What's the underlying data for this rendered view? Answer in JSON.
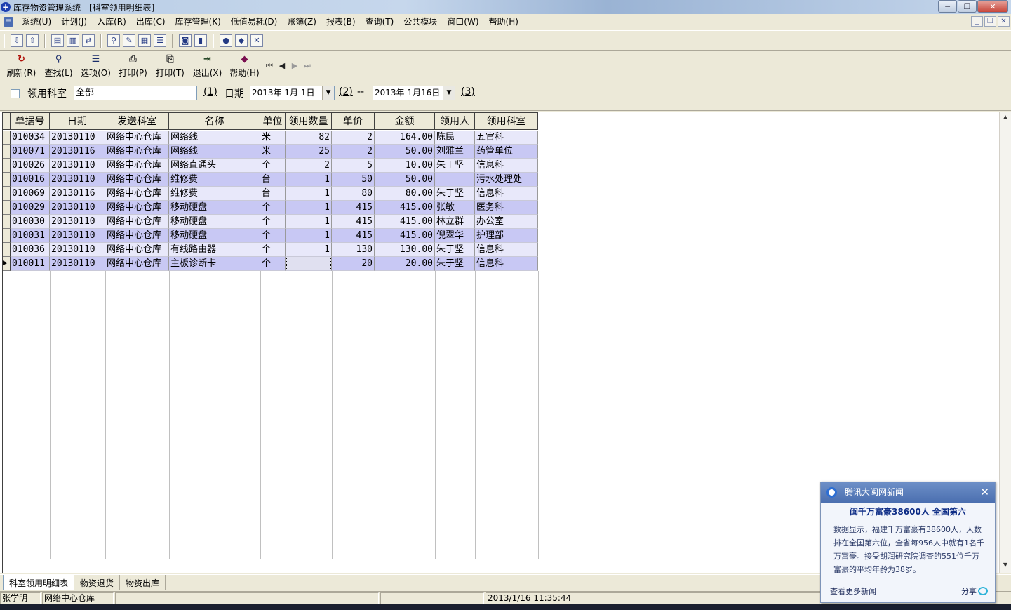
{
  "window": {
    "title": "库存物资管理系统 - [科室领用明细表]",
    "btn_minimize": "─",
    "btn_restore": "❐",
    "btn_close": "✕"
  },
  "menu": {
    "items": [
      "系统(U)",
      "计划(J)",
      "入库(R)",
      "出库(C)",
      "库存管理(K)",
      "低值易耗(D)",
      "账簿(Z)",
      "报表(B)",
      "查询(T)",
      "公共模块",
      "窗口(W)",
      "帮助(H)"
    ],
    "mdi_minimize": "_",
    "mdi_restore": "❐",
    "mdi_close": "✕"
  },
  "toolbar2": {
    "buttons": [
      {
        "label": "刷新(R)",
        "icon": "refresh-icon",
        "glyph": "↻"
      },
      {
        "label": "查找(L)",
        "icon": "search-icon",
        "glyph": "⚲"
      },
      {
        "label": "选项(O)",
        "icon": "options-icon",
        "glyph": "☰"
      },
      {
        "label": "打印(P)",
        "icon": "printer-icon",
        "glyph": "⎙"
      },
      {
        "label": "打印(T)",
        "icon": "print-preview-icon",
        "glyph": "⎘"
      },
      {
        "label": "退出(X)",
        "icon": "exit-icon",
        "glyph": "⇥"
      },
      {
        "label": "帮助(H)",
        "icon": "help-book-icon",
        "glyph": "◆"
      }
    ],
    "nav": [
      "⏮",
      "◀",
      "▶",
      "⏭"
    ]
  },
  "filter": {
    "dept_label": "领用科室",
    "dept_value": "全部",
    "marker1": "(1)",
    "date_label": "日期",
    "date_from": "2013年 1月 1日",
    "marker2": "(2)",
    "separator": "--",
    "date_to": "2013年 1月16日",
    "marker3": "(3)"
  },
  "table": {
    "columns": [
      "单据号",
      "日期",
      "发送科室",
      "名称",
      "单位",
      "领用数量",
      "单价",
      "金额",
      "领用人",
      "领用科室"
    ],
    "rows": [
      [
        "010034",
        "20130110",
        "网络中心仓库",
        "网络线",
        "米",
        "82",
        "2",
        "164.00",
        "陈民",
        "五官科"
      ],
      [
        "010071",
        "20130116",
        "网络中心仓库",
        "网络线",
        "米",
        "25",
        "2",
        "50.00",
        "刘雅兰",
        "药管单位"
      ],
      [
        "010026",
        "20130110",
        "网络中心仓库",
        "网络直通头",
        "个",
        "2",
        "5",
        "10.00",
        "朱于坚",
        "信息科"
      ],
      [
        "010016",
        "20130110",
        "网络中心仓库",
        "维修费",
        "台",
        "1",
        "50",
        "50.00",
        "",
        "污水处理处"
      ],
      [
        "010069",
        "20130116",
        "网络中心仓库",
        "维修费",
        "台",
        "1",
        "80",
        "80.00",
        "朱于坚",
        "信息科"
      ],
      [
        "010029",
        "20130110",
        "网络中心仓库",
        "移动硬盘",
        "个",
        "1",
        "415",
        "415.00",
        "张敏",
        "医务科"
      ],
      [
        "010030",
        "20130110",
        "网络中心仓库",
        "移动硬盘",
        "个",
        "1",
        "415",
        "415.00",
        "林立群",
        "办公室"
      ],
      [
        "010031",
        "20130110",
        "网络中心仓库",
        "移动硬盘",
        "个",
        "1",
        "415",
        "415.00",
        "倪翠华",
        "护理部"
      ],
      [
        "010036",
        "20130110",
        "网络中心仓库",
        "有线路由器",
        "个",
        "1",
        "130",
        "130.00",
        "朱于坚",
        "信息科"
      ],
      [
        "010011",
        "20130110",
        "网络中心仓库",
        "主板诊断卡",
        "个",
        "",
        "20",
        "20.00",
        "朱于坚",
        "信息科"
      ]
    ],
    "current_row_marker": "▶"
  },
  "tabs": [
    "科室领用明细表",
    "物资退货",
    "物资出库"
  ],
  "status": {
    "user": "张学明",
    "warehouse": "网络中心仓库",
    "datetime": "2013/1/16 11:35:44"
  },
  "popup": {
    "header": "腾讯大闽网新闻",
    "close": "✕",
    "title": "闽千万富豪38600人 全国第六",
    "body": "数据显示，福建千万富豪有38600人，人数排在全国第六位，全省每956人中就有1名千万富豪。接受胡润研究院调查的551位千万富豪的平均年龄为38岁。",
    "more": "查看更多新闻",
    "share": "分享"
  }
}
